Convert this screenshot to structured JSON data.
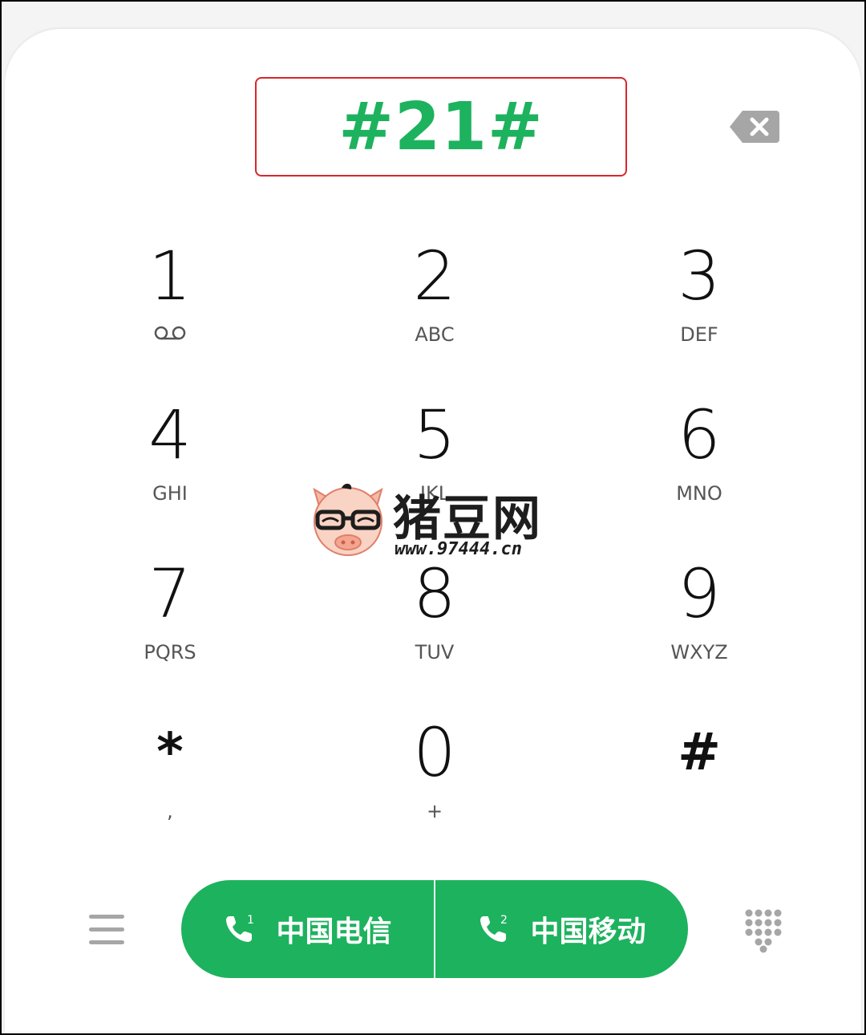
{
  "display": {
    "number": "#21#"
  },
  "keypad": [
    {
      "digit": "1",
      "sub": "",
      "sub_icon": "voicemail-icon"
    },
    {
      "digit": "2",
      "sub": "ABC"
    },
    {
      "digit": "3",
      "sub": "DEF"
    },
    {
      "digit": "4",
      "sub": "GHI"
    },
    {
      "digit": "5",
      "sub": "JKL"
    },
    {
      "digit": "6",
      "sub": "MNO"
    },
    {
      "digit": "7",
      "sub": "PQRS"
    },
    {
      "digit": "8",
      "sub": "TUV"
    },
    {
      "digit": "9",
      "sub": "WXYZ"
    },
    {
      "digit": "*",
      "sub": ","
    },
    {
      "digit": "0",
      "sub": "+"
    },
    {
      "digit": "#",
      "sub": ""
    }
  ],
  "call_buttons": {
    "sim1": {
      "label": "中国电信",
      "sim_index": "1",
      "icon": "phone-sim1-icon"
    },
    "sim2": {
      "label": "中国移动",
      "sim_index": "2",
      "icon": "phone-sim2-icon"
    }
  },
  "watermark": {
    "text": "猪豆网",
    "url": "www.97444.cn"
  },
  "colors": {
    "accent": "#1db25e",
    "highlight_border": "#d9262b",
    "icon_gray": "#a6a6a6"
  },
  "icons": {
    "backspace": "backspace-icon",
    "menu": "menu-icon",
    "keypad_toggle": "dialpad-icon"
  }
}
